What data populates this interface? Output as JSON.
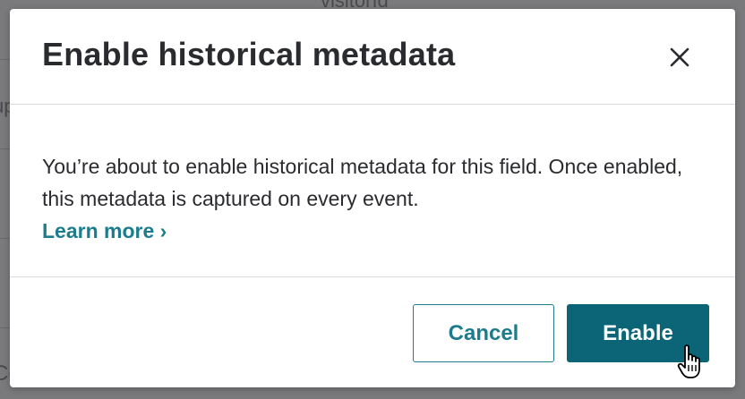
{
  "background": {
    "top_text": "visitorId",
    "left_text_1": "up",
    "left_text_2": "Co"
  },
  "modal": {
    "title": "Enable historical metadata",
    "body_text": "You’re about to enable historical metadata for this field. Once enabled, this metadata is captured on every event.",
    "learn_more_label": "Learn more ›",
    "cancel_label": "Cancel",
    "enable_label": "Enable"
  },
  "colors": {
    "accent": "#1c7c8c",
    "primary_button": "#0b6577",
    "title_text": "#2a2b2e",
    "divider": "#dadbdd",
    "backdrop": "#7a7a7d"
  },
  "icons": {
    "close": "close-icon",
    "cursor": "hand-pointer-cursor-icon"
  }
}
